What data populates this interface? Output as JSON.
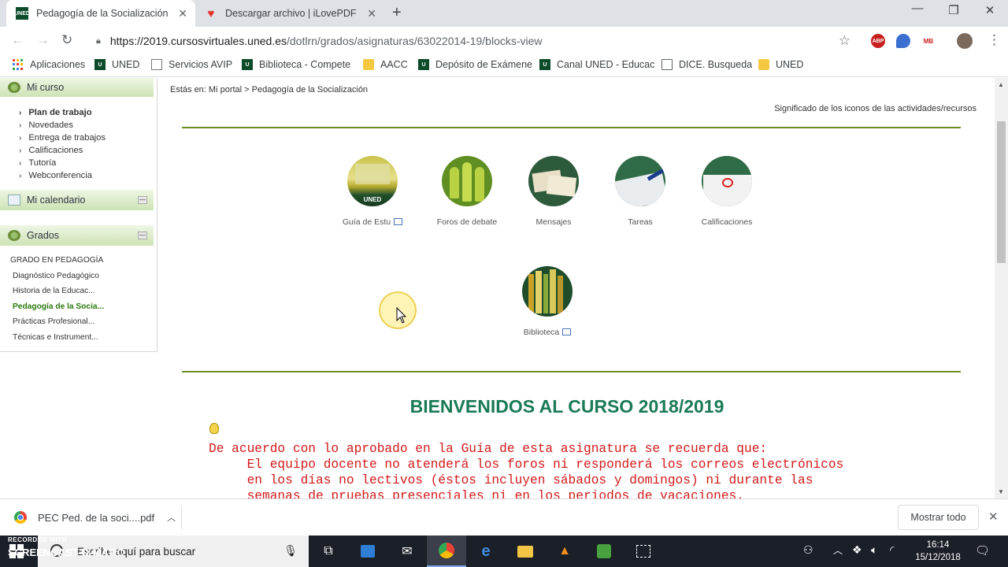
{
  "browser": {
    "tabs": [
      {
        "title": "Pedagogía de la Socialización",
        "favicon": "uned-icon",
        "active": true
      },
      {
        "title": "Descargar archivo | iLovePDF",
        "favicon": "ilovepdf-heart-icon",
        "active": false
      }
    ],
    "url": {
      "host": "https://2019.cursosvirtuales.uned.es",
      "path": "/dotlrn/grados/asignaturas/63022014-19/blocks-view"
    },
    "extensions": [
      "ABP",
      "MB"
    ],
    "bookmarks": [
      {
        "label": "Aplicaciones",
        "icon": "apps-grid-icon"
      },
      {
        "label": "UNED",
        "icon": "uned-icon"
      },
      {
        "label": "Servicios AVIP",
        "icon": "avip-icon"
      },
      {
        "label": "Biblioteca - Compete",
        "icon": "uned-icon"
      },
      {
        "label": "AACC",
        "icon": "folder-icon"
      },
      {
        "label": "Depósito de Exámene",
        "icon": "uned-icon"
      },
      {
        "label": "Canal UNED - Educac",
        "icon": "uned-icon"
      },
      {
        "label": "DICE. Busqueda",
        "icon": "page-icon"
      },
      {
        "label": "UNED",
        "icon": "folder-icon"
      }
    ]
  },
  "sidebar": {
    "mi_curso": {
      "title": "Mi curso",
      "items": [
        "Plan de trabajo",
        "Novedades",
        "Entrega de trabajos",
        "Calificaciones",
        "Tutoría",
        "Webconferencia"
      ]
    },
    "calendario": {
      "title": "Mi calendario"
    },
    "grados": {
      "title": "Grados",
      "degree": "GRADO EN PEDAGOGÍA",
      "courses": [
        "Diagnóstico Pedagógico",
        "Historia de la Educac...",
        "Pedagogía de la Socia...",
        "Prácticas Profesional...",
        "Técnicas e Instrument..."
      ]
    }
  },
  "main": {
    "breadcrumb": {
      "prefix": "Estás en:",
      "home": "Mi portal",
      "sep": ">",
      "current": "Pedagogía de la Socialización"
    },
    "legend_link": "Significado de los iconos de las actividades/recursos",
    "resources": [
      {
        "label": "Guía de Estu",
        "icon": "study-guide-icon"
      },
      {
        "label": "Foros de debate",
        "icon": "forum-people-icon"
      },
      {
        "label": "Mensajes",
        "icon": "messages-letters-icon"
      },
      {
        "label": "Tareas",
        "icon": "tasks-writing-icon"
      },
      {
        "label": "Calificaciones",
        "icon": "grades-paper-icon"
      },
      {
        "label": "Biblioteca",
        "icon": "library-books-icon"
      }
    ],
    "welcome": "BIENVENIDOS AL CURSO 2018/2019",
    "notice_lines": [
      "De acuerdo con lo aprobado en la Guía de esta asignatura se recuerda que:",
      "     El equipo docente no atenderá los foros ni responderá los correos electrónicos",
      "     en los días no lectivos (éstos incluyen sábados y domingos) ni durante las",
      "     semanas de pruebas presenciales ni en los periodos de vacaciones."
    ]
  },
  "downloads": {
    "file": "PEC Ped. de la soci....pdf",
    "show_all": "Mostrar todo"
  },
  "taskbar": {
    "search_placeholder": "Escribe aquí para buscar",
    "watermark_top": "RECORDED WITH",
    "watermark_brand": "SCREENCAST-O-MATIC",
    "time": "16:14",
    "date": "15/12/2018"
  },
  "colors": {
    "accent_green": "#6b8e23",
    "welcome": "#1a7a55",
    "notice_red": "#d11a1a"
  }
}
